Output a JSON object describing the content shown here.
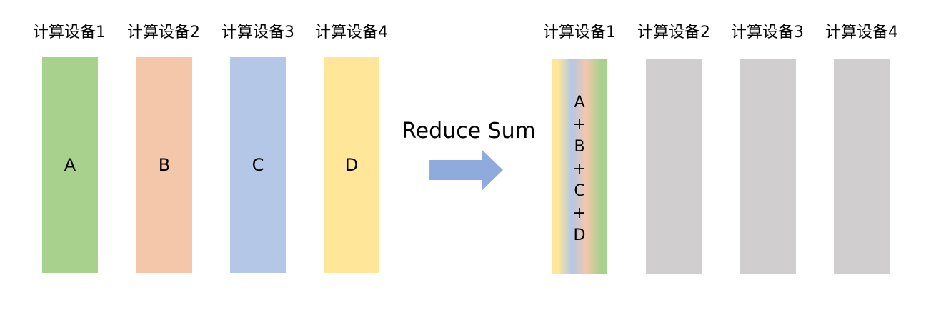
{
  "left_group": {
    "devices": [
      {
        "label": "计算设备1",
        "value": "A",
        "color": "#a9d18e"
      },
      {
        "label": "计算设备2",
        "value": "B",
        "color": "#f4c7ab"
      },
      {
        "label": "计算设备3",
        "value": "C",
        "color": "#b4c7e7"
      },
      {
        "label": "计算设备4",
        "value": "D",
        "color": "#ffe699"
      }
    ]
  },
  "operation": {
    "label": "Reduce Sum",
    "arrow_color": "#8faadc"
  },
  "right_group": {
    "devices": [
      {
        "label": "计算设备1",
        "color": "gradient"
      },
      {
        "label": "计算设备2",
        "color": "#d0cece"
      },
      {
        "label": "计算设备3",
        "color": "#d0cece"
      },
      {
        "label": "计算设备4",
        "color": "#d0cece"
      }
    ],
    "sum_terms": [
      "A",
      "+",
      "B",
      "+",
      "C",
      "+",
      "D"
    ]
  }
}
